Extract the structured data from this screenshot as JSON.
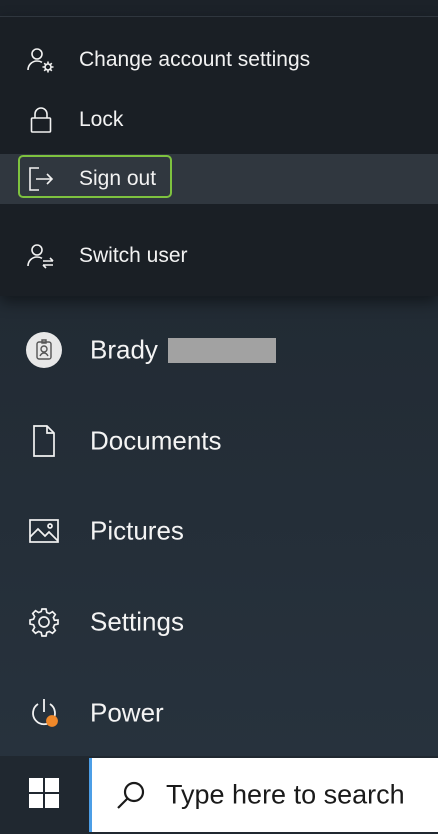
{
  "account_menu": {
    "items": [
      {
        "label": "Change account settings",
        "icon": "user-gear-icon"
      },
      {
        "label": "Lock",
        "icon": "lock-icon"
      },
      {
        "label": "Sign out",
        "icon": "sign-out-icon"
      },
      {
        "label": "Switch user",
        "icon": "switch-user-icon"
      }
    ],
    "focused_item": "Sign out",
    "focus_color": "#7ec23f"
  },
  "start_menu": {
    "user": {
      "name": "Brady",
      "icon": "user-avatar-icon"
    },
    "items": [
      {
        "label": "Documents",
        "icon": "document-icon"
      },
      {
        "label": "Pictures",
        "icon": "picture-icon"
      },
      {
        "label": "Settings",
        "icon": "gear-icon"
      },
      {
        "label": "Power",
        "icon": "power-icon",
        "badge_color": "#f0892a"
      }
    ]
  },
  "taskbar": {
    "start_icon": "windows-logo-icon",
    "search": {
      "placeholder": "Type here to search",
      "icon": "search-icon"
    }
  }
}
